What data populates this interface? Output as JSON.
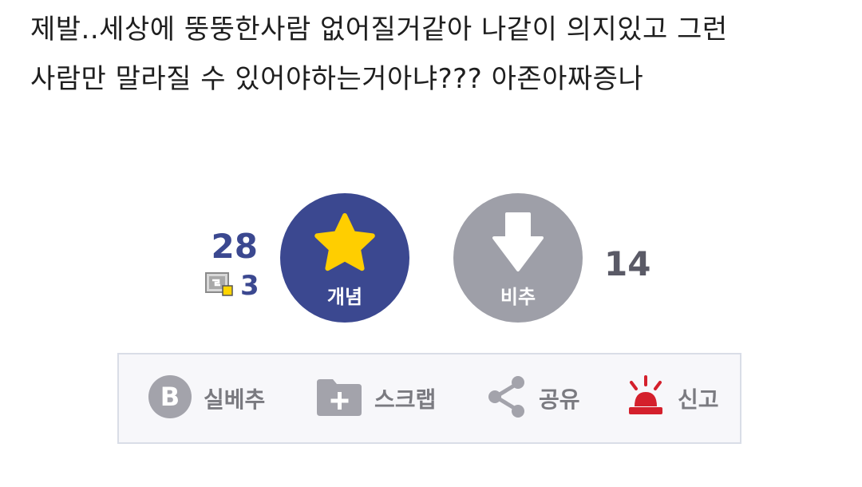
{
  "post": {
    "line1": "제발..세상에 뚱뚱한사람 없어질거같아 나같이 의지있고 그런",
    "line2": "사람만 말라질 수 있어야하는거아냐??? 아존아짜증나"
  },
  "votes": {
    "recommend_count": "28",
    "fixed_count": "3",
    "upvote_label": "개념",
    "downvote_label": "비추",
    "nonrecommend_count": "14"
  },
  "actions": {
    "best_label": "실베추",
    "best_icon_letter": "B",
    "scrap_label": "스크랩",
    "share_label": "공유",
    "report_label": "신고"
  },
  "colors": {
    "accent": "#3b4890",
    "downvote": "#9e9fa8",
    "star": "#ffce00",
    "report": "#d4202c",
    "action_text": "#7a7a80"
  },
  "icons": {
    "upvote": "star-icon",
    "downvote": "arrow-down-icon",
    "fixed": "fixed-user-icon",
    "best": "b-circle-icon",
    "scrap": "folder-plus-icon",
    "share": "share-icon",
    "report": "siren-icon"
  }
}
